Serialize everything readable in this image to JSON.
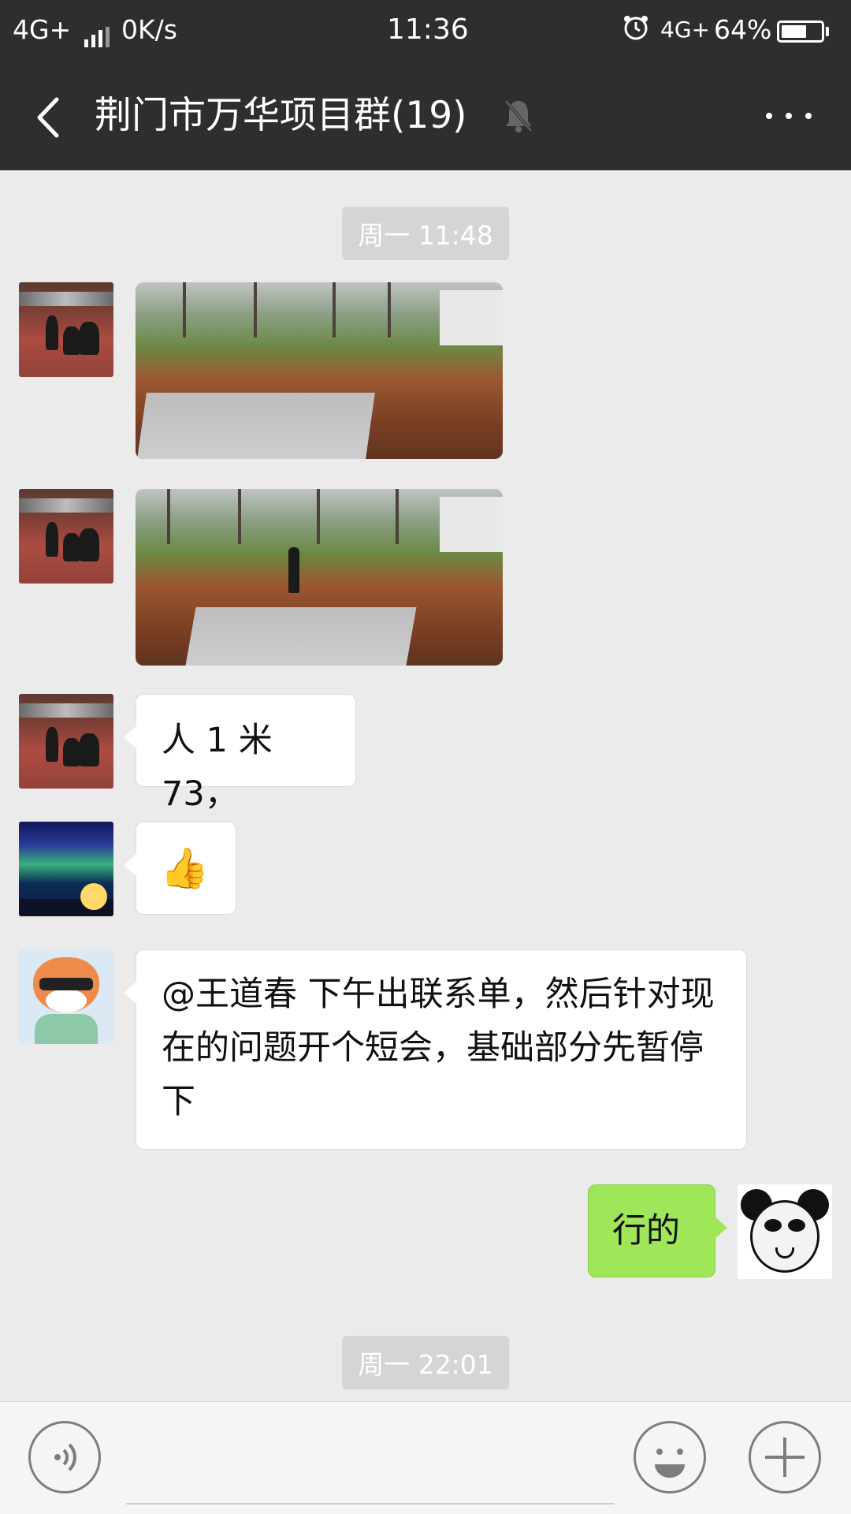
{
  "status_bar": {
    "network": "4G+",
    "speed": "0K/s",
    "time": "11:36",
    "network_right": "4G+",
    "battery_percent": "64%",
    "battery_level": 0.64
  },
  "header": {
    "title": "荆门市万华项目群(19)"
  },
  "messages": {
    "timestamp_1": "周一 11:48",
    "text_height": "人 1 米 73，",
    "text_thumb": "👍",
    "text_long": "@王道春  下午出联系单，然后针对现在的问题开个短会，基础部分先暂停下",
    "text_self": "行的",
    "timestamp_2": "周一 22:01"
  },
  "icons": {
    "back": "back-arrow-icon",
    "mute": "bell-mute-icon",
    "more": "more-icon",
    "voice": "voice-icon",
    "emoji": "emoji-icon",
    "plus": "plus-icon",
    "alarm": "alarm-icon"
  },
  "colors": {
    "header_bg": "#2e2e2e",
    "chat_bg": "#ebebeb",
    "self_bubble": "#9fe658",
    "other_bubble": "#ffffff"
  }
}
